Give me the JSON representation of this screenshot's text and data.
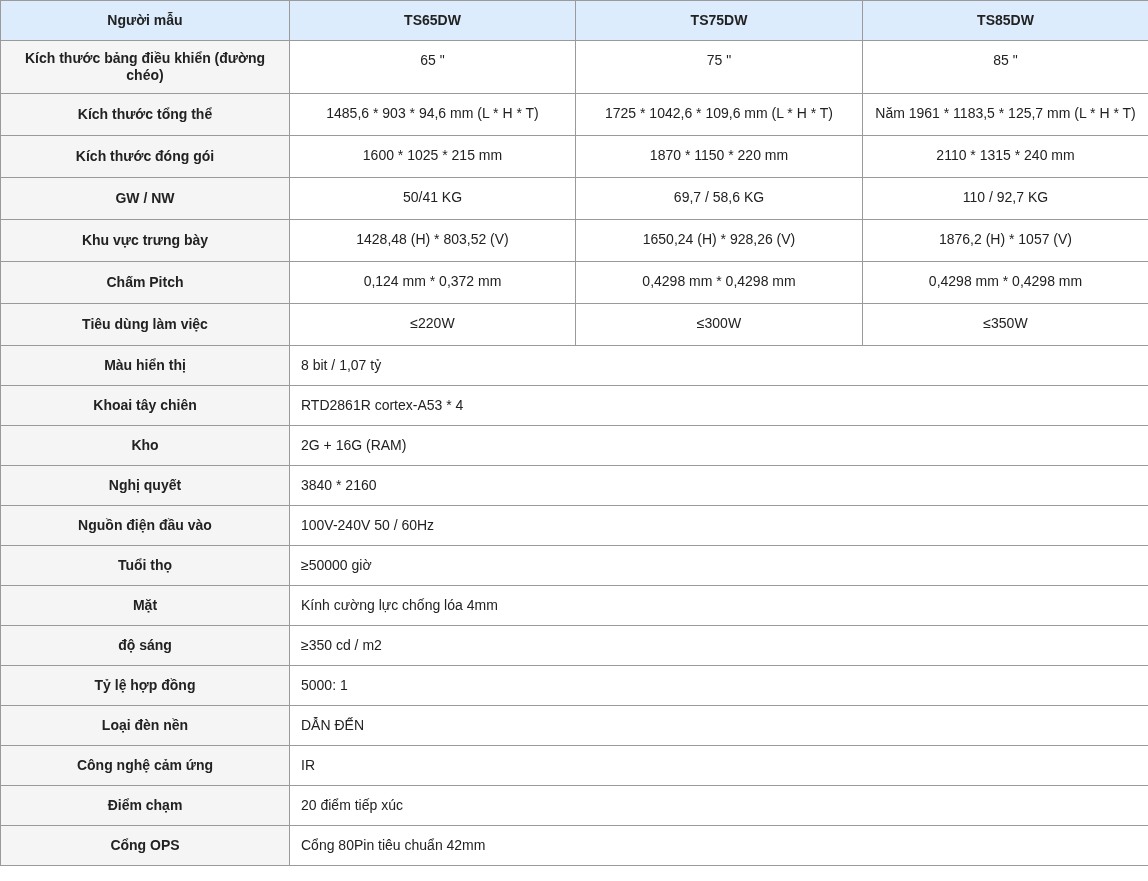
{
  "table": {
    "columns": [
      "Người mẫu",
      "TS65DW",
      "TS75DW",
      "TS85DW"
    ],
    "rows": [
      {
        "label": "Kích thước bảng điều khiển (đường chéo)",
        "values": [
          "65 \"",
          "75 \"",
          "85 \""
        ]
      },
      {
        "label": "Kích thước tổng thể",
        "values": [
          "1485,6 * 903 * 94,6 mm (L * H * T)",
          "1725 * 1042,6 * 109,6 mm (L * H * T)",
          "Năm 1961 * 1183,5 * 125,7 mm (L * H * T)"
        ]
      },
      {
        "label": "Kích thước đóng gói",
        "values": [
          "1600 * 1025 * 215 mm",
          "1870 * 1150 * 220 mm",
          "2110 * 1315 * 240 mm"
        ]
      },
      {
        "label": "GW / NW",
        "values": [
          "50/41 KG",
          "69,7 / 58,6 KG",
          "110 / 92,7 KG"
        ]
      },
      {
        "label": "Khu vực trưng bày",
        "values": [
          "1428,48 (H) * 803,52 (V)",
          "1650,24 (H) * 928,26 (V)",
          "1876,2 (H) * 1057 (V)"
        ]
      },
      {
        "label": "Chấm Pitch",
        "values": [
          "0,124 mm * 0,372 mm",
          "0,4298 mm * 0,4298 mm",
          "0,4298 mm * 0,4298 mm"
        ]
      },
      {
        "label": "Tiêu dùng làm việc",
        "values": [
          "≤220W",
          "≤300W",
          "≤350W"
        ]
      },
      {
        "label": "Màu hiển thị",
        "values": [
          "8 bit / 1,07 tỷ"
        ]
      },
      {
        "label": "Khoai tây chiên",
        "values": [
          "RTD2861R cortex-A53 * 4"
        ]
      },
      {
        "label": "Kho",
        "values": [
          "2G + 16G (RAM)"
        ]
      },
      {
        "label": "Nghị quyết",
        "values": [
          "3840 * 2160"
        ]
      },
      {
        "label": "Nguồn điện đầu vào",
        "values": [
          "100V-240V 50 / 60Hz"
        ]
      },
      {
        "label": "Tuổi thọ",
        "values": [
          "≥50000 giờ"
        ]
      },
      {
        "label": "Mặt",
        "values": [
          "Kính cường lực chống lóa 4mm"
        ]
      },
      {
        "label": "độ sáng",
        "values": [
          "≥350 cd / m2"
        ]
      },
      {
        "label": "Tỷ lệ hợp đồng",
        "values": [
          "5000: 1"
        ]
      },
      {
        "label": "Loại đèn nền",
        "values": [
          "DẪN ĐẾN"
        ]
      },
      {
        "label": "Công nghệ cảm ứng",
        "values": [
          "IR"
        ]
      },
      {
        "label": "Điểm chạm",
        "values": [
          "20 điểm tiếp xúc"
        ]
      },
      {
        "label": "Cổng OPS",
        "values": [
          "Cổng 80Pin tiêu chuẩn 42mm"
        ]
      }
    ]
  }
}
